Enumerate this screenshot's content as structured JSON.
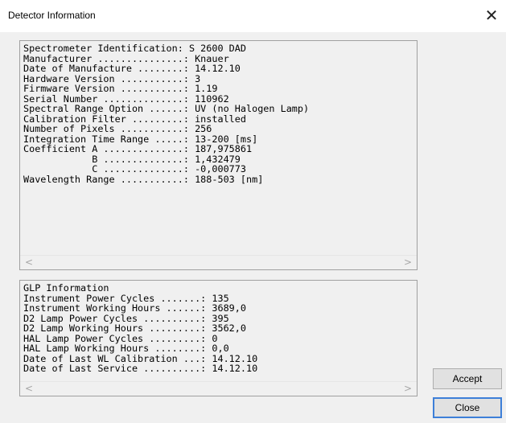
{
  "window": {
    "title": "Detector Information",
    "close_glyph": "✕",
    "close_icon": "close-icon"
  },
  "detector_panel": {
    "text": "Spectrometer Identification: S 2600 DAD\nManufacturer ...............: Knauer\nDate of Manufacture ........: 14.12.10\nHardware Version ...........: 3\nFirmware Version ...........: 1.19\nSerial Number ..............: 110962\nSpectral Range Option ......: UV (no Halogen Lamp)\nCalibration Filter .........: installed\nNumber of Pixels ...........: 256\nIntegration Time Range .....: 13-200 [ms]\nCoefficient A ..............: 187,975861\n            B ..............: 1,432479\n            C ..............: -0,000773\nWavelength Range ...........: 188-503 [nm]",
    "scroll_left_glyph": "<",
    "scroll_right_glyph": ">"
  },
  "glp_panel": {
    "text": "GLP Information\nInstrument Power Cycles .......: 135\nInstrument Working Hours ......: 3689,0\nD2 Lamp Power Cycles ..........: 395\nD2 Lamp Working Hours .........: 3562,0\nHAL Lamp Power Cycles .........: 0\nHAL Lamp Working Hours ........: 0,0\nDate of Last WL Calibration ...: 14.12.10\nDate of Last Service ..........: 14.12.10",
    "scroll_left_glyph": "<",
    "scroll_right_glyph": ">"
  },
  "buttons": {
    "accept_label": "Accept",
    "close_label": "Close"
  }
}
